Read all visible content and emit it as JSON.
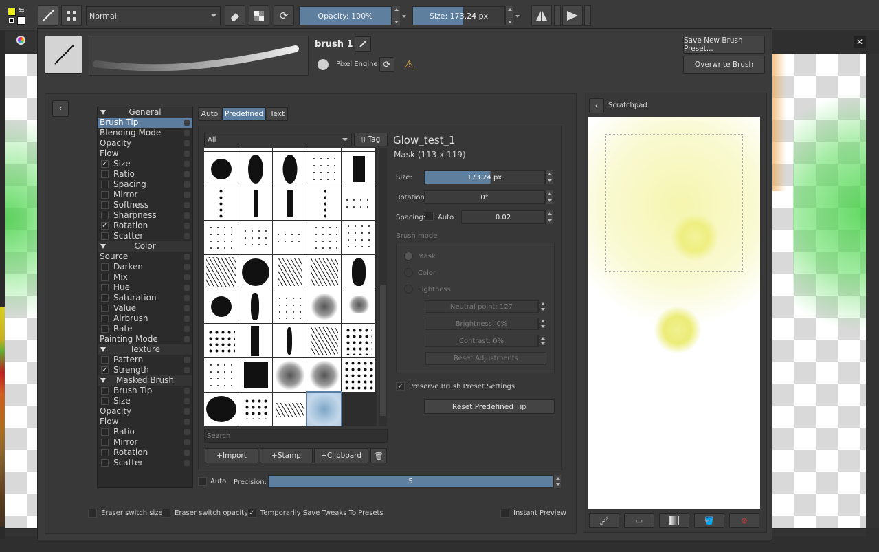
{
  "toolbar": {
    "blend_mode": "Normal",
    "opacity": "Opacity: 100%",
    "size": "Size: 173.24 px"
  },
  "dialog": {
    "preset_name": "brush 1",
    "engine": "Pixel Engine",
    "save_new_preset": "Save New Brush Preset...",
    "overwrite": "Overwrite Brush"
  },
  "options": [
    {
      "label": "General",
      "type": "header"
    },
    {
      "label": "Brush Tip",
      "type": "plain",
      "selected": true
    },
    {
      "label": "Blending Mode",
      "type": "plain"
    },
    {
      "label": "Opacity",
      "type": "plain"
    },
    {
      "label": "Flow",
      "type": "plain"
    },
    {
      "label": "Size",
      "type": "check",
      "checked": true
    },
    {
      "label": "Ratio",
      "type": "check"
    },
    {
      "label": "Spacing",
      "type": "check"
    },
    {
      "label": "Mirror",
      "type": "check"
    },
    {
      "label": "Softness",
      "type": "check"
    },
    {
      "label": "Sharpness",
      "type": "check"
    },
    {
      "label": "Rotation",
      "type": "check",
      "checked": true
    },
    {
      "label": "Scatter",
      "type": "check"
    },
    {
      "label": "Color",
      "type": "header"
    },
    {
      "label": "Source",
      "type": "plain"
    },
    {
      "label": "Darken",
      "type": "check"
    },
    {
      "label": "Mix",
      "type": "check"
    },
    {
      "label": "Hue",
      "type": "check"
    },
    {
      "label": "Saturation",
      "type": "check"
    },
    {
      "label": "Value",
      "type": "check"
    },
    {
      "label": "Airbrush",
      "type": "check"
    },
    {
      "label": "Rate",
      "type": "check"
    },
    {
      "label": "Painting Mode",
      "type": "plain"
    },
    {
      "label": "Texture",
      "type": "header"
    },
    {
      "label": "Pattern",
      "type": "check"
    },
    {
      "label": "Strength",
      "type": "check",
      "checked": true
    },
    {
      "label": "Masked Brush",
      "type": "header"
    },
    {
      "label": "Brush Tip",
      "type": "check"
    },
    {
      "label": "Size",
      "type": "check"
    },
    {
      "label": "Opacity",
      "type": "plain"
    },
    {
      "label": "Flow",
      "type": "plain"
    },
    {
      "label": "Ratio",
      "type": "check"
    },
    {
      "label": "Mirror",
      "type": "check"
    },
    {
      "label": "Rotation",
      "type": "check"
    },
    {
      "label": "Scatter",
      "type": "check"
    }
  ],
  "tabs": [
    "Auto",
    "Predefined",
    "Text"
  ],
  "filter": {
    "value": "All",
    "tag": "Tag"
  },
  "search_placeholder": "Search",
  "actions": {
    "import": "Import",
    "stamp": "Stamp",
    "clipboard": "Clipboard"
  },
  "tip": {
    "name": "Glow_test_1",
    "mask": "Mask (113 x 119)",
    "size_label": "Size:",
    "size_value": "173.24 px",
    "rotation_label": "Rotation:",
    "rotation_value": "0°",
    "spacing_label": "Spacing:",
    "spacing_auto": "Auto",
    "spacing_value": "0.02",
    "brush_mode": "Brush mode",
    "mode_mask": "Mask",
    "mode_color": "Color",
    "mode_lightness": "Lightness",
    "neutral": "Neutral point: 127",
    "brightness": "Brightness: 0%",
    "contrast": "Contrast: 0%",
    "reset_adj": "Reset Adjustments",
    "preserve": "Preserve Brush Preset Settings",
    "reset_tip": "Reset Predefined Tip"
  },
  "precision": {
    "auto": "Auto",
    "label": "Precision:",
    "value": "5"
  },
  "scratchpad": {
    "title": "Scratchpad"
  },
  "footer": {
    "eraser_size": "Eraser switch size",
    "eraser_opacity": "Eraser switch opacity",
    "temp_save": "Temporarily Save Tweaks To Presets",
    "instant": "Instant Preview"
  },
  "colors": {
    "accent": "#5c7d9e",
    "bg": "#3b3b3b"
  }
}
